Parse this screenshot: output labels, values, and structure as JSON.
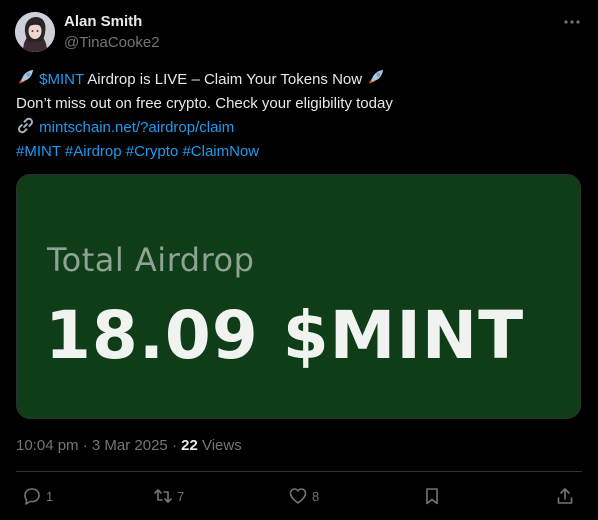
{
  "author": {
    "display_name": "Alan Smith",
    "handle": "@TinaCooke2",
    "avatar_icon": "avatar-portrait"
  },
  "tweet": {
    "line1": {
      "ticker": "$MINT",
      "text": " Airdrop is LIVE – Claim Your Tokens Now "
    },
    "line2": "Don’t miss out on free crypto. Check your eligibility today",
    "url": "mintschain.net/?airdrop/claim",
    "hashtags": "#MINT #Airdrop #Crypto #ClaimNow"
  },
  "card": {
    "label": "Total Airdrop",
    "value": "18.09 $MINT",
    "background": "#0f3d18"
  },
  "meta": {
    "time": "10:04 pm",
    "date": "3 Mar 2025",
    "views_count": "22",
    "views_label": "Views"
  },
  "actions": {
    "replies": "1",
    "retweets": "7",
    "likes": "8"
  },
  "colors": {
    "link": "#1d9bf0",
    "muted": "#71767b",
    "text": "#e7e9ea"
  }
}
